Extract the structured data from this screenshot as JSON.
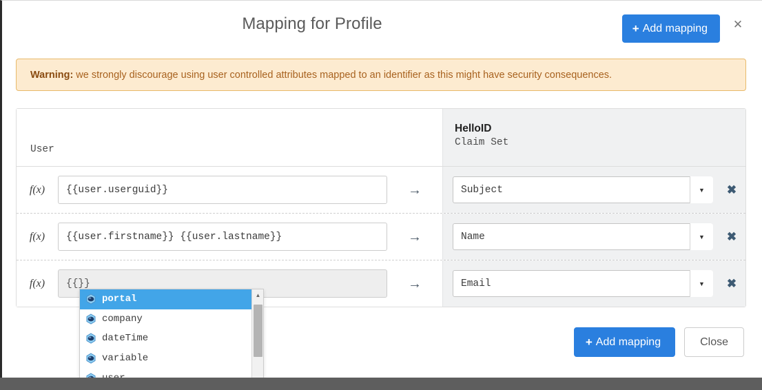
{
  "modal": {
    "title": "Mapping for Profile",
    "close_icon": "close-icon",
    "add_mapping_label": "Add mapping",
    "plus_glyph": "+"
  },
  "warning": {
    "label": "Warning:",
    "text": "we strongly discourage using user controlled attributes mapped to an identifier as this might have security consequences.",
    "bg_color": "#fdebd0",
    "border_color": "#e8b96a",
    "text_color": "#a8621f"
  },
  "table": {
    "left_header": "User",
    "right_header_title": "HelloID",
    "right_header_sub": "Claim Set",
    "fx_label": "f(x)",
    "arrow_glyph": "→",
    "remove_glyph": "✖",
    "caret_glyph": "▼",
    "rows": [
      {
        "fx": "f(x)",
        "expression": "{{user.userguid}}",
        "placeholder": "",
        "muted": false,
        "claim": "Subject"
      },
      {
        "fx": "f(x)",
        "expression": "{{user.firstname}} {{user.lastname}}",
        "placeholder": "",
        "muted": false,
        "claim": "Name"
      },
      {
        "fx": "f(x)",
        "expression": "{{}}",
        "placeholder": "",
        "muted": true,
        "claim": "Email"
      }
    ]
  },
  "autocomplete": {
    "items": [
      {
        "label": "portal",
        "icon": "object-icon",
        "active": true
      },
      {
        "label": "company",
        "icon": "object-icon",
        "active": false
      },
      {
        "label": "dateTime",
        "icon": "object-icon",
        "active": false
      },
      {
        "label": "variable",
        "icon": "object-icon",
        "active": false
      },
      {
        "label": "user",
        "icon": "object-icon",
        "active": false
      }
    ],
    "highlight_color": "#42a5e8",
    "scroll_up_glyph": "▲",
    "scroll_down_glyph": "▼"
  },
  "footer": {
    "add_mapping_label": "Add mapping",
    "close_label": "Close",
    "plus_glyph": "+"
  },
  "theme": {
    "primary": "#2a7fdf",
    "panel_gray": "#f0f1f2",
    "bottom_strip": "#5e5e5e"
  }
}
